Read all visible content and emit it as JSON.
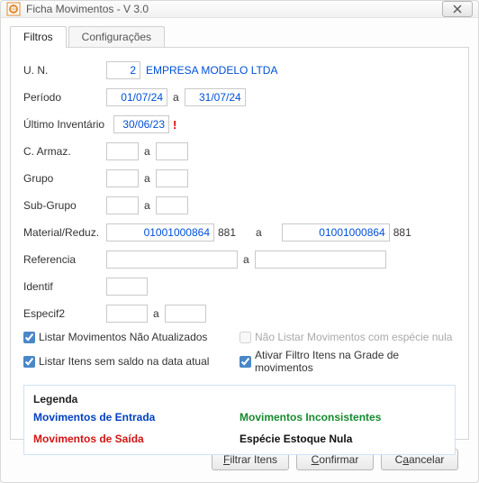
{
  "window": {
    "title": "Ficha Movimentos - V 3.0"
  },
  "tabs": {
    "filtros": "Filtros",
    "config": "Configurações"
  },
  "labels": {
    "un": "U. N.",
    "periodo": "Período",
    "ultimo_inventario": "Último Inventário",
    "c_armaz": "C. Armaz.",
    "grupo": "Grupo",
    "sub_grupo": "Sub-Grupo",
    "material": "Material/Reduz.",
    "referencia": "Referencia",
    "identif": "Identif",
    "especif2": "Especif2",
    "a": "a"
  },
  "values": {
    "un": "2",
    "company": "EMPRESA MODELO LTDA",
    "periodo_from": "01/07/24",
    "periodo_to": "31/07/24",
    "ultimo_inventario": "30/06/23",
    "c_armaz_from": "",
    "c_armaz_to": "",
    "grupo_from": "",
    "grupo_to": "",
    "subgrupo_from": "",
    "subgrupo_to": "",
    "material_from": "01001000864",
    "material_from_suffix": "881",
    "material_to": "01001000864",
    "material_to_suffix": "881",
    "referencia_from": "",
    "referencia_to": "",
    "identif": "",
    "especif2_from": "",
    "especif2_to": ""
  },
  "checks": {
    "listar_nao_atualizados": "Listar Movimentos Não Atualizados",
    "nao_listar_especie_nula": "Não Listar Movimentos com espécie nula",
    "listar_sem_saldo": "Listar Itens sem saldo na data atual",
    "ativar_filtro_grade": "Ativar Filtro Itens na Grade de movimentos"
  },
  "legend": {
    "title": "Legenda",
    "entrada": "Movimentos de Entrada",
    "inconsistentes": "Movimentos Inconsistentes",
    "saida": "Movimentos de Saída",
    "especie_nula": "Espécie Estoque Nula"
  },
  "buttons": {
    "filtrar": "iltrar Itens",
    "confirmar": "onfirmar",
    "cancelar": "ancelar"
  },
  "warn": "!"
}
